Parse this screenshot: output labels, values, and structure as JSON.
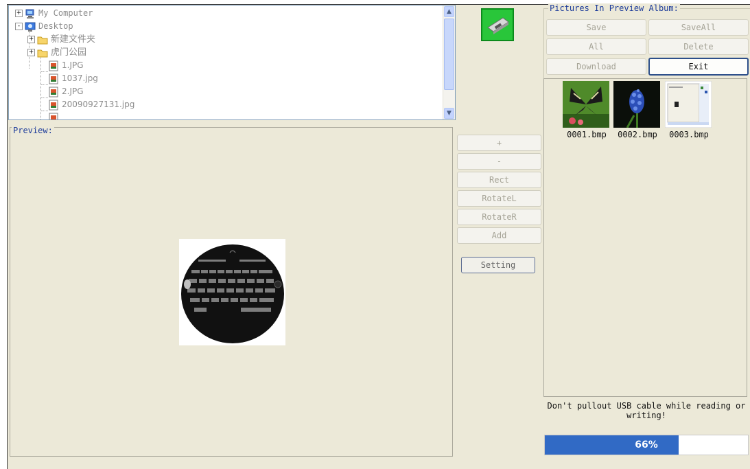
{
  "tree": {
    "items": [
      {
        "label": "My Computer",
        "icon": "computer-icon",
        "expander": "+"
      },
      {
        "label": "Desktop",
        "icon": "desktop-icon",
        "expander": "-"
      },
      {
        "label": "新建文件夹",
        "icon": "folder-icon",
        "expander": "+"
      },
      {
        "label": "虎门公园",
        "icon": "folder-icon",
        "expander": "+"
      },
      {
        "label": "1.JPG",
        "icon": "image-file-icon"
      },
      {
        "label": "1037.jpg",
        "icon": "image-file-icon"
      },
      {
        "label": "2.JPG",
        "icon": "image-file-icon"
      },
      {
        "label": "20090927131.jpg",
        "icon": "image-file-icon"
      }
    ],
    "scroll_up": "▲",
    "scroll_down": "▼"
  },
  "preview": {
    "title": "Preview:"
  },
  "controls": {
    "zoom_in": "+",
    "zoom_out": "-",
    "rect": "Rect",
    "rotate_left": "RotateL",
    "rotate_right": "RotateR",
    "add": "Add",
    "setting": "Setting"
  },
  "album": {
    "title": "Pictures In Preview Album:",
    "save": "Save",
    "save_all": "SaveAll",
    "all": "All",
    "delete": "Delete",
    "download": "Download",
    "exit": "Exit",
    "thumbnails": [
      {
        "name": "0001.bmp"
      },
      {
        "name": "0002.bmp"
      },
      {
        "name": "0003.bmp"
      }
    ]
  },
  "status": {
    "warning": "Don't pullout USB cable while reading or writing!",
    "progress_percent": 66,
    "progress_label": "66%"
  },
  "colors": {
    "accent": "#316ac5",
    "group_title": "#1c3b9a",
    "background": "#ece9d8",
    "connect_button": "#29c63a"
  }
}
